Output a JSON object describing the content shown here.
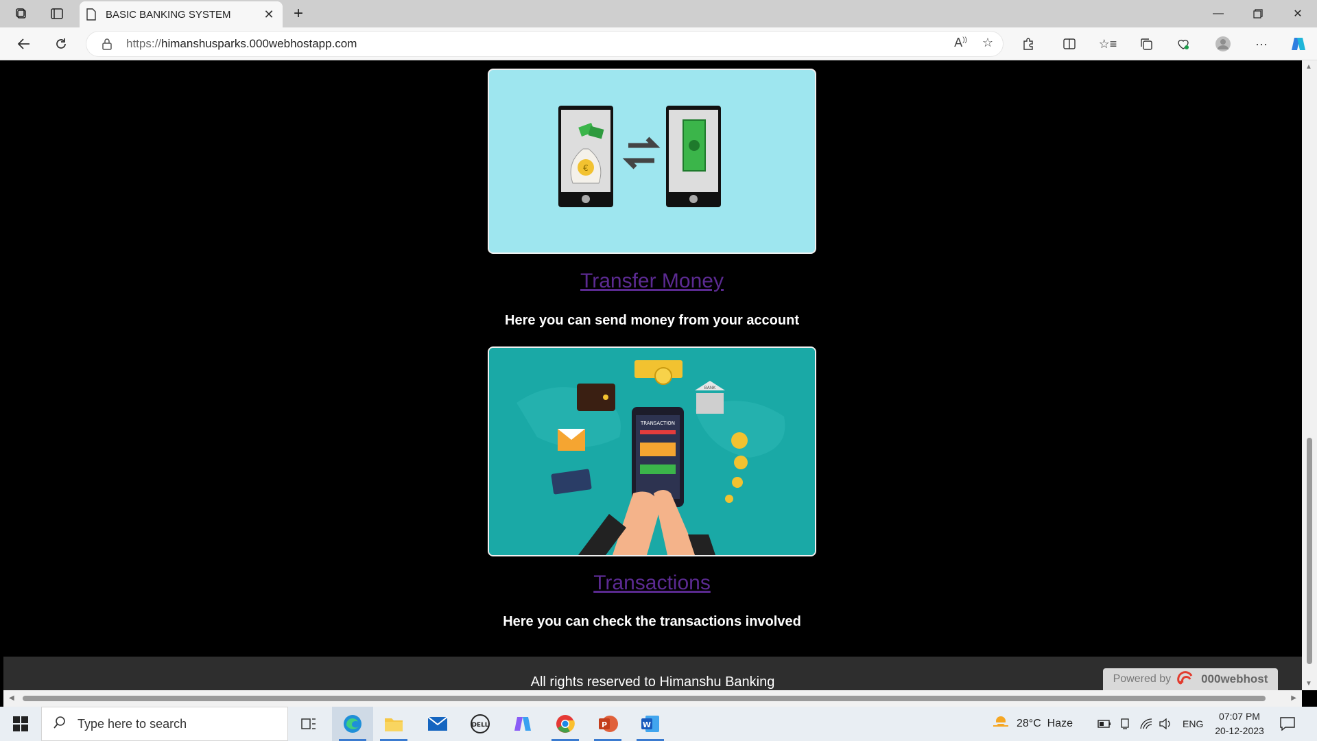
{
  "browser": {
    "tab_title": "BASIC BANKING SYSTEM",
    "url_protocol": "https://",
    "url_host": "himanshusparks.000webhostapp.com"
  },
  "page": {
    "cards": [
      {
        "link": "Transfer Money",
        "description": "Here you can send money from your account"
      },
      {
        "link": "Transactions",
        "description": "Here you can check the transactions involved",
        "image_text": "TRANSACTION",
        "bank_label": "BANK"
      }
    ],
    "footer_text": "All rights reserved to Himanshu Banking",
    "powered_by": "Powered by",
    "powered_brand": "000webhost"
  },
  "taskbar": {
    "search_placeholder": "Type here to search",
    "weather": "28°C  Haze",
    "language": "ENG",
    "time": "07:07 PM",
    "date": "20-12-2023"
  },
  "colors": {
    "link": "#5b2a91",
    "transfer_bg": "#9ee6ef",
    "transactions_bg": "#1aa9a6",
    "footer_bg": "#2e2e2e"
  }
}
